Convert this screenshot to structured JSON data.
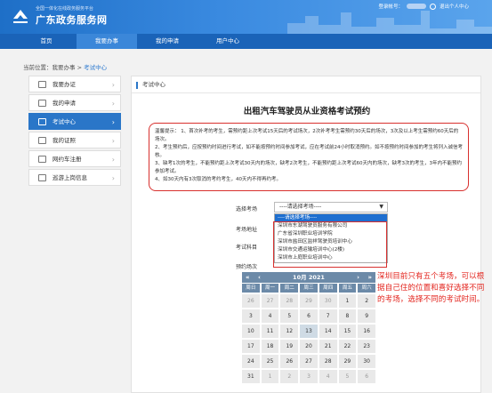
{
  "header": {
    "brand_sub": "全国一体化在线政务服务平台",
    "brand": "广东政务服务网",
    "login_label": "登录帐号：",
    "logout_label": "退出个人中心"
  },
  "nav": [
    {
      "label": "首页"
    },
    {
      "label": "我要办事"
    },
    {
      "label": "我的申请"
    },
    {
      "label": "用户中心"
    }
  ],
  "breadcrumb": {
    "prefix": "当前位置：我要办事 > ",
    "current": "考试中心"
  },
  "sidebar": [
    {
      "label": "我要办证",
      "icon": "person-icon"
    },
    {
      "label": "我的申请",
      "icon": "document-icon"
    },
    {
      "label": "考试中心",
      "icon": "exam-icon",
      "active": true
    },
    {
      "label": "我的证照",
      "icon": "certificate-icon"
    },
    {
      "label": "网约车注册",
      "icon": "car-icon"
    },
    {
      "label": "巡游上岗信息",
      "icon": "id-card-icon"
    }
  ],
  "main": {
    "section_title": "考试中心",
    "page_title": "出租汽车驾驶员从业资格考试预约",
    "notice": [
      "温馨提示：  1、首次补考的考生，需预约距上次考试15天后的考试场次，2次补考考生需预约30天后的场次，3次及以上考生需预约60天后的场次。",
      "2、考生预约后，应按预约时间进行考试，如不能按预约时间参加考试，应在考试前24小时取消预约。如不按预约时间参加的考生将列入诚信考核。",
      "3、缺考1次的考生，不能预约距上次考试30天内的场次，缺考2次考生，不能预约距上次考试60天内的场次，缺考3次的考生，3年内不能预约参加考试。",
      "4、如30天内有3次取消的考约考生，40天内不得再约考。"
    ],
    "form": {
      "exam_site_label": "选择考场",
      "exam_site_value": "----请选择考场----",
      "address_label": "考场地址",
      "subject_label": "考试科目",
      "slot_label": "预约场次"
    },
    "dropdown_options": [
      "----请选择考场----",
      "深圳市东湖驾驶员服务有限公司",
      "广东省深圳职业培训学院",
      "深圳市盐田区监祥驾驶员培训中心",
      "深圳市交通运输培训中心(2楼)",
      "深圳市上庭职业培训中心"
    ]
  },
  "calendar": {
    "title": "10月 2021",
    "prev": "«",
    "prev2": "‹",
    "next": "›",
    "next2": "»",
    "weekdays": [
      "周日",
      "周一",
      "周二",
      "周三",
      "周四",
      "周五",
      "周六"
    ],
    "weeks": [
      [
        "26",
        "27",
        "28",
        "29",
        "30",
        "1",
        "2"
      ],
      [
        "3",
        "4",
        "5",
        "6",
        "7",
        "8",
        "9"
      ],
      [
        "10",
        "11",
        "12",
        "13",
        "14",
        "15",
        "16"
      ],
      [
        "17",
        "18",
        "19",
        "20",
        "21",
        "22",
        "23"
      ],
      [
        "24",
        "25",
        "26",
        "27",
        "28",
        "29",
        "30"
      ],
      [
        "31",
        "1",
        "2",
        "3",
        "4",
        "5",
        "6"
      ]
    ]
  },
  "annotation": "深圳目前只有五个考场，可以根据自己住的位置和喜好选择不同的考场，选择不同的考试时间。",
  "colors": {
    "header": "#1e6fc7",
    "nav": "#1a63b8",
    "active": "#2a76c8",
    "highlight": "#d8302e",
    "calendar_head": "#6c8aa8"
  }
}
